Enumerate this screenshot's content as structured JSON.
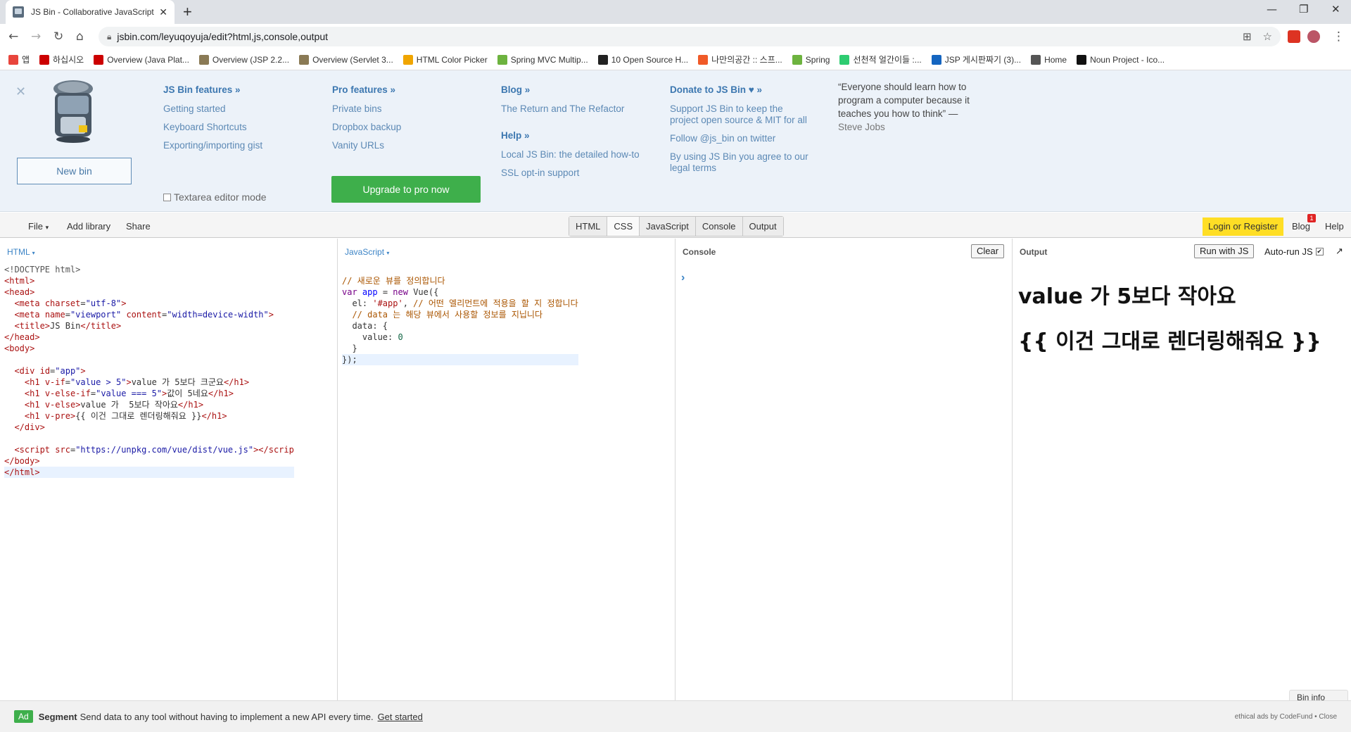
{
  "browser": {
    "tab_title": "JS Bin - Collaborative JavaScript",
    "url": "jsbin.com/leyuqoyuja/edit?html,js,console,output",
    "bookmarks": [
      {
        "label": "앱",
        "color": "#e8453c"
      },
      {
        "label": "하십시오",
        "color": "#c00"
      },
      {
        "label": "Overview (Java Plat...",
        "color": "#c00"
      },
      {
        "label": "Overview (JSP 2.2...",
        "color": "#8a7a55"
      },
      {
        "label": "Overview (Servlet 3...",
        "color": "#8a7a55"
      },
      {
        "label": "HTML Color Picker",
        "color": "#f0a500"
      },
      {
        "label": "Spring MVC Multip...",
        "color": "#6db33f"
      },
      {
        "label": "10 Open Source H...",
        "color": "#222"
      },
      {
        "label": "나만의공간 :: 스프...",
        "color": "#f05a28"
      },
      {
        "label": "Spring",
        "color": "#6db33f"
      },
      {
        "label": "선천적 얼간이들 :...",
        "color": "#2ecc71"
      },
      {
        "label": "JSP 게시판짜기 (3)...",
        "color": "#1565c0"
      },
      {
        "label": "Home",
        "color": "#555"
      },
      {
        "label": "Noun Project - Ico...",
        "color": "#111"
      }
    ]
  },
  "info": {
    "new_bin": "New bin",
    "textarea_mode": "Textarea editor mode",
    "upgrade": "Upgrade to pro now",
    "col1": {
      "heading": "JS Bin features »",
      "links": [
        "Getting started",
        "Keyboard Shortcuts",
        "Exporting/importing gist"
      ]
    },
    "col2": {
      "heading": "Pro features »",
      "links": [
        "Private bins",
        "Dropbox backup",
        "Vanity URLs"
      ]
    },
    "col3": {
      "heading": "Blog »",
      "links": [
        "The Return and The Refactor"
      ],
      "heading2": "Help »",
      "links2": [
        "Local JS Bin: the detailed how-to",
        "SSL opt-in support"
      ]
    },
    "col4": {
      "heading": "Donate to JS Bin ♥ »",
      "links": [
        "Support JS Bin to keep the project open source & MIT for all",
        "Follow @js_bin on twitter",
        "By using JS Bin you agree to our legal terms"
      ]
    },
    "quote": "“Everyone should learn how to program a computer because it teaches you how to think” —",
    "quote_author": "Steve Jobs"
  },
  "controls": {
    "file": "File",
    "add_library": "Add library",
    "share": "Share",
    "tabs": [
      "HTML",
      "CSS",
      "JavaScript",
      "Console",
      "Output"
    ],
    "login": "Login or Register",
    "blog": "Blog",
    "blog_count": "1",
    "help": "Help"
  },
  "panels": {
    "html_label": "HTML",
    "js_label": "JavaScript",
    "console_label": "Console",
    "console_clear": "Clear",
    "output_label": "Output",
    "run_with_js": "Run with JS",
    "auto_run": "Auto-run JS",
    "output_h1_1": "value 가 5보다 작아요",
    "output_h1_2": "{{ 이건 그대로 렌더링해줘요 }}",
    "bin_info": "Bin info"
  },
  "ad": {
    "tag": "Ad",
    "brand": "Segment",
    "text": "Send data to any tool without having to implement a new API every time.",
    "cta": "Get started",
    "right": "ethical ads by CodeFund • Close"
  }
}
